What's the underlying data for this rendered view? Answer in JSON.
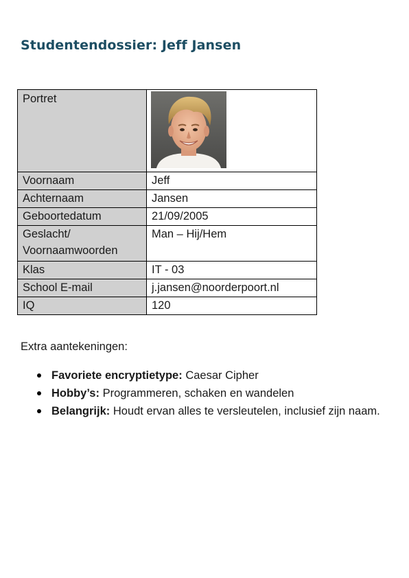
{
  "title": "Studentendossier: Jeff Jansen",
  "record": {
    "portrait_label": "Portret",
    "rows": [
      {
        "label": "Voornaam",
        "value": "Jeff"
      },
      {
        "label": "Achternaam",
        "value": "Jansen"
      },
      {
        "label": "Geboortedatum",
        "value": "21/09/2005"
      },
      {
        "label": "Geslacht/ Voornaamwoorden",
        "value": "Man – Hij/Hem"
      },
      {
        "label": "Klas",
        "value": "IT - 03"
      },
      {
        "label": "School E-mail",
        "value": "j.jansen@noorderpoort.nl"
      },
      {
        "label": "IQ",
        "value": "120"
      }
    ]
  },
  "notes": {
    "heading": "Extra aantekeningen:",
    "items": [
      {
        "term": "Favoriete encryptietype:",
        "text": " Caesar Cipher"
      },
      {
        "term": "Hobby’s:",
        "text": " Programmeren, schaken en wandelen"
      },
      {
        "term": "Belangrijk:",
        "text": " Houdt ervan alles te versleutelen, inclusief zijn naam."
      }
    ]
  },
  "colors": {
    "title": "#1d4e63",
    "label_background": "#d0d0d0"
  }
}
